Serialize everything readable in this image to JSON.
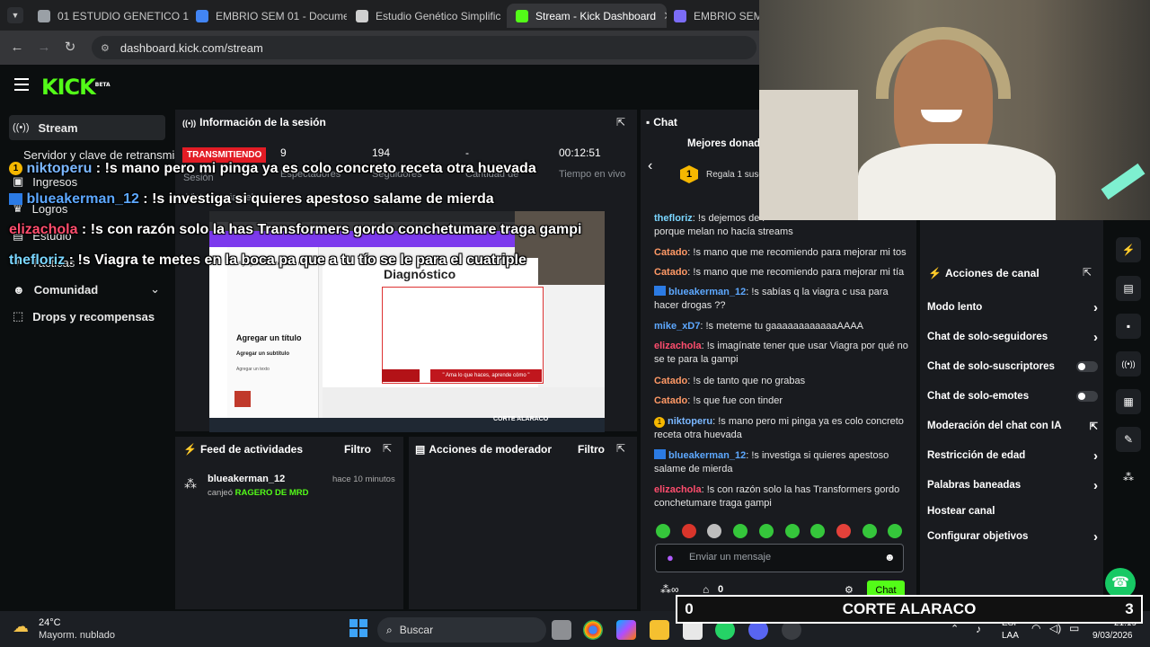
{
  "browser": {
    "tabs": [
      {
        "label": "01 ESTUDIO GENETICO 1 (",
        "color": "#9aa0a6"
      },
      {
        "label": "EMBRIO SEM 01 - Docume",
        "color": "#4285f4"
      },
      {
        "label": "Estudio Genético Simplific",
        "color": "#cfcfcf"
      },
      {
        "label": "Stream - Kick Dashboard",
        "color": "#53fc18"
      },
      {
        "label": "EMBRIO SEM 01",
        "color": "#7b6cf6"
      }
    ],
    "url": "dashboard.kick.com/stream"
  },
  "sidebar": {
    "logo": "KICK",
    "logo_badge": "BETA",
    "items": [
      {
        "label": "Stream",
        "icon": "broadcast-icon"
      },
      {
        "label": "Servidor y clave de retransmisión"
      },
      {
        "label": "Ingresos"
      },
      {
        "label": "Logros"
      },
      {
        "label": "Estudio"
      },
      {
        "label": "Tácticas"
      },
      {
        "label": "Comunidad"
      },
      {
        "label": "Drops y recompensas"
      }
    ]
  },
  "session": {
    "title": "Información de la sesión",
    "live_badge": "TRANSMITIENDO",
    "session_label": "Sesión",
    "stats": [
      {
        "value": "9",
        "label": "Espectadores"
      },
      {
        "value": "194",
        "label": "Seguidores"
      },
      {
        "value": "-",
        "label": "Cantidad de"
      },
      {
        "value": "00:12:51",
        "label": "Tiempo en vivo"
      }
    ],
    "preview_label": "Vista previa del stream"
  },
  "preview": {
    "slide_title": "Diagnóstico",
    "menu_title": "Agregar un título",
    "menu_sub": "Agregar un subtítulo",
    "menu_body": "Agregar un texto",
    "menu_brand": "Agrega las fuentes de tu marca",
    "quote": "\" Ama lo que haces, aprende cómo \"",
    "footer_name": "CORTE ALARACO",
    "buscar": "Buscar"
  },
  "overlay": [
    {
      "user": "niktoperu",
      "text": " : !s mano pero mi pinga ya es colo concreto receta otra huevada",
      "color": "#7ab7ff"
    },
    {
      "user": "blueakerman_12",
      "text": " : !s investiga si quieres apestoso salame de mierda",
      "color": "#5da8ff"
    },
    {
      "user": "elizachola",
      "text": " : !s con razón solo la has Transformers gordo conchetumare traga gampi",
      "color": "#ff4d6d"
    },
    {
      "user": "thefloriz",
      "text": " : !s Viagra te metes en la boca pa que a tu tío se le para el cuatriple",
      "color": "#7ad6ff"
    }
  ],
  "activity": {
    "title": "Feed de actividades",
    "filter": "Filtro",
    "user": "blueakerman_12",
    "time": "hace 10 minutos",
    "action": "canjeó",
    "reward": "RAGERO DE MRD"
  },
  "moderator": {
    "title": "Acciones de moderador",
    "filter": "Filtro"
  },
  "chat": {
    "title": "Chat",
    "top_donors": "Mejores donado",
    "gift_text": "Regala 1 susc",
    "gift_count": "1",
    "placeholder": "Enviar un mensaje",
    "points": "0",
    "send_label": "Chat",
    "messages": [
      {
        "user": "thefloriz",
        "text": ": !s dejemos de l",
        "extra": "porque melan no hacía streams",
        "color": "#7ad6ff",
        "badge": ""
      },
      {
        "user": "Catado",
        "text": ": !s mano que me recomiendo para mejorar mi tos",
        "color": "#ff9966",
        "badge": ""
      },
      {
        "user": "Catado",
        "text": ": !s mano que me recomiendo para mejorar mi tía",
        "color": "#ff9966",
        "badge": ""
      },
      {
        "user": "blueakerman_12",
        "text": ": !s sabías q la viagra c usa para hacer drogas ??",
        "color": "#5da8ff",
        "badge": "blue"
      },
      {
        "user": "mike_xD7",
        "text": ": !s meteme tu gaaaaaaaaaaaaAAAA",
        "color": "#5da8ff",
        "badge": ""
      },
      {
        "user": "elizachola",
        "text": ": !s imagínate tener que usar Viagra por qué no se te para la gampi",
        "color": "#ff4d6d",
        "badge": ""
      },
      {
        "user": "Catado",
        "text": ": !s de tanto que no grabas",
        "color": "#ff9966",
        "badge": ""
      },
      {
        "user": "Catado",
        "text": ": !s que fue con tinder",
        "color": "#ff9966",
        "badge": ""
      },
      {
        "user": "niktoperu",
        "text": ": !s mano pero mi pinga ya es colo concreto receta otra huevada",
        "color": "#7ab7ff",
        "badge": "gold"
      },
      {
        "user": "blueakerman_12",
        "text": ": !s investiga si quieres apestoso salame de mierda",
        "color": "#5da8ff",
        "badge": "blue"
      },
      {
        "user": "elizachola",
        "text": ": !s con razón solo la has Transformers gordo conchetumare traga gampi",
        "color": "#ff4d6d",
        "badge": ""
      }
    ]
  },
  "channel_actions": {
    "title": "Acciones de canal",
    "items": [
      {
        "label": "Modo lento",
        "control": "chevron"
      },
      {
        "label": "Chat de solo-seguidores",
        "control": "chevron"
      },
      {
        "label": "Chat de solo-suscriptores",
        "control": "toggle"
      },
      {
        "label": "Chat de solo-emotes",
        "control": "toggle"
      },
      {
        "label": "Moderación del chat con IA",
        "control": "external"
      },
      {
        "label": "Restricción de edad",
        "control": "chevron"
      },
      {
        "label": "Palabras baneadas",
        "control": "chevron"
      },
      {
        "label": "Hostear canal",
        "control": "none"
      },
      {
        "label": "Configurar objetivos",
        "control": "chevron"
      }
    ]
  },
  "scoreboard": {
    "left": "0",
    "name": "CORTE ALARACO",
    "right": "3"
  },
  "taskbar": {
    "weather_temp": "24°C",
    "weather_desc": "Mayorm. nublado",
    "search": "Buscar",
    "lang1": "ESP",
    "lang2": "LAA",
    "time": "21:19",
    "date": "9/03/2026"
  },
  "colors": {
    "kick_green": "#53fc18",
    "live_red": "#e31c25"
  }
}
